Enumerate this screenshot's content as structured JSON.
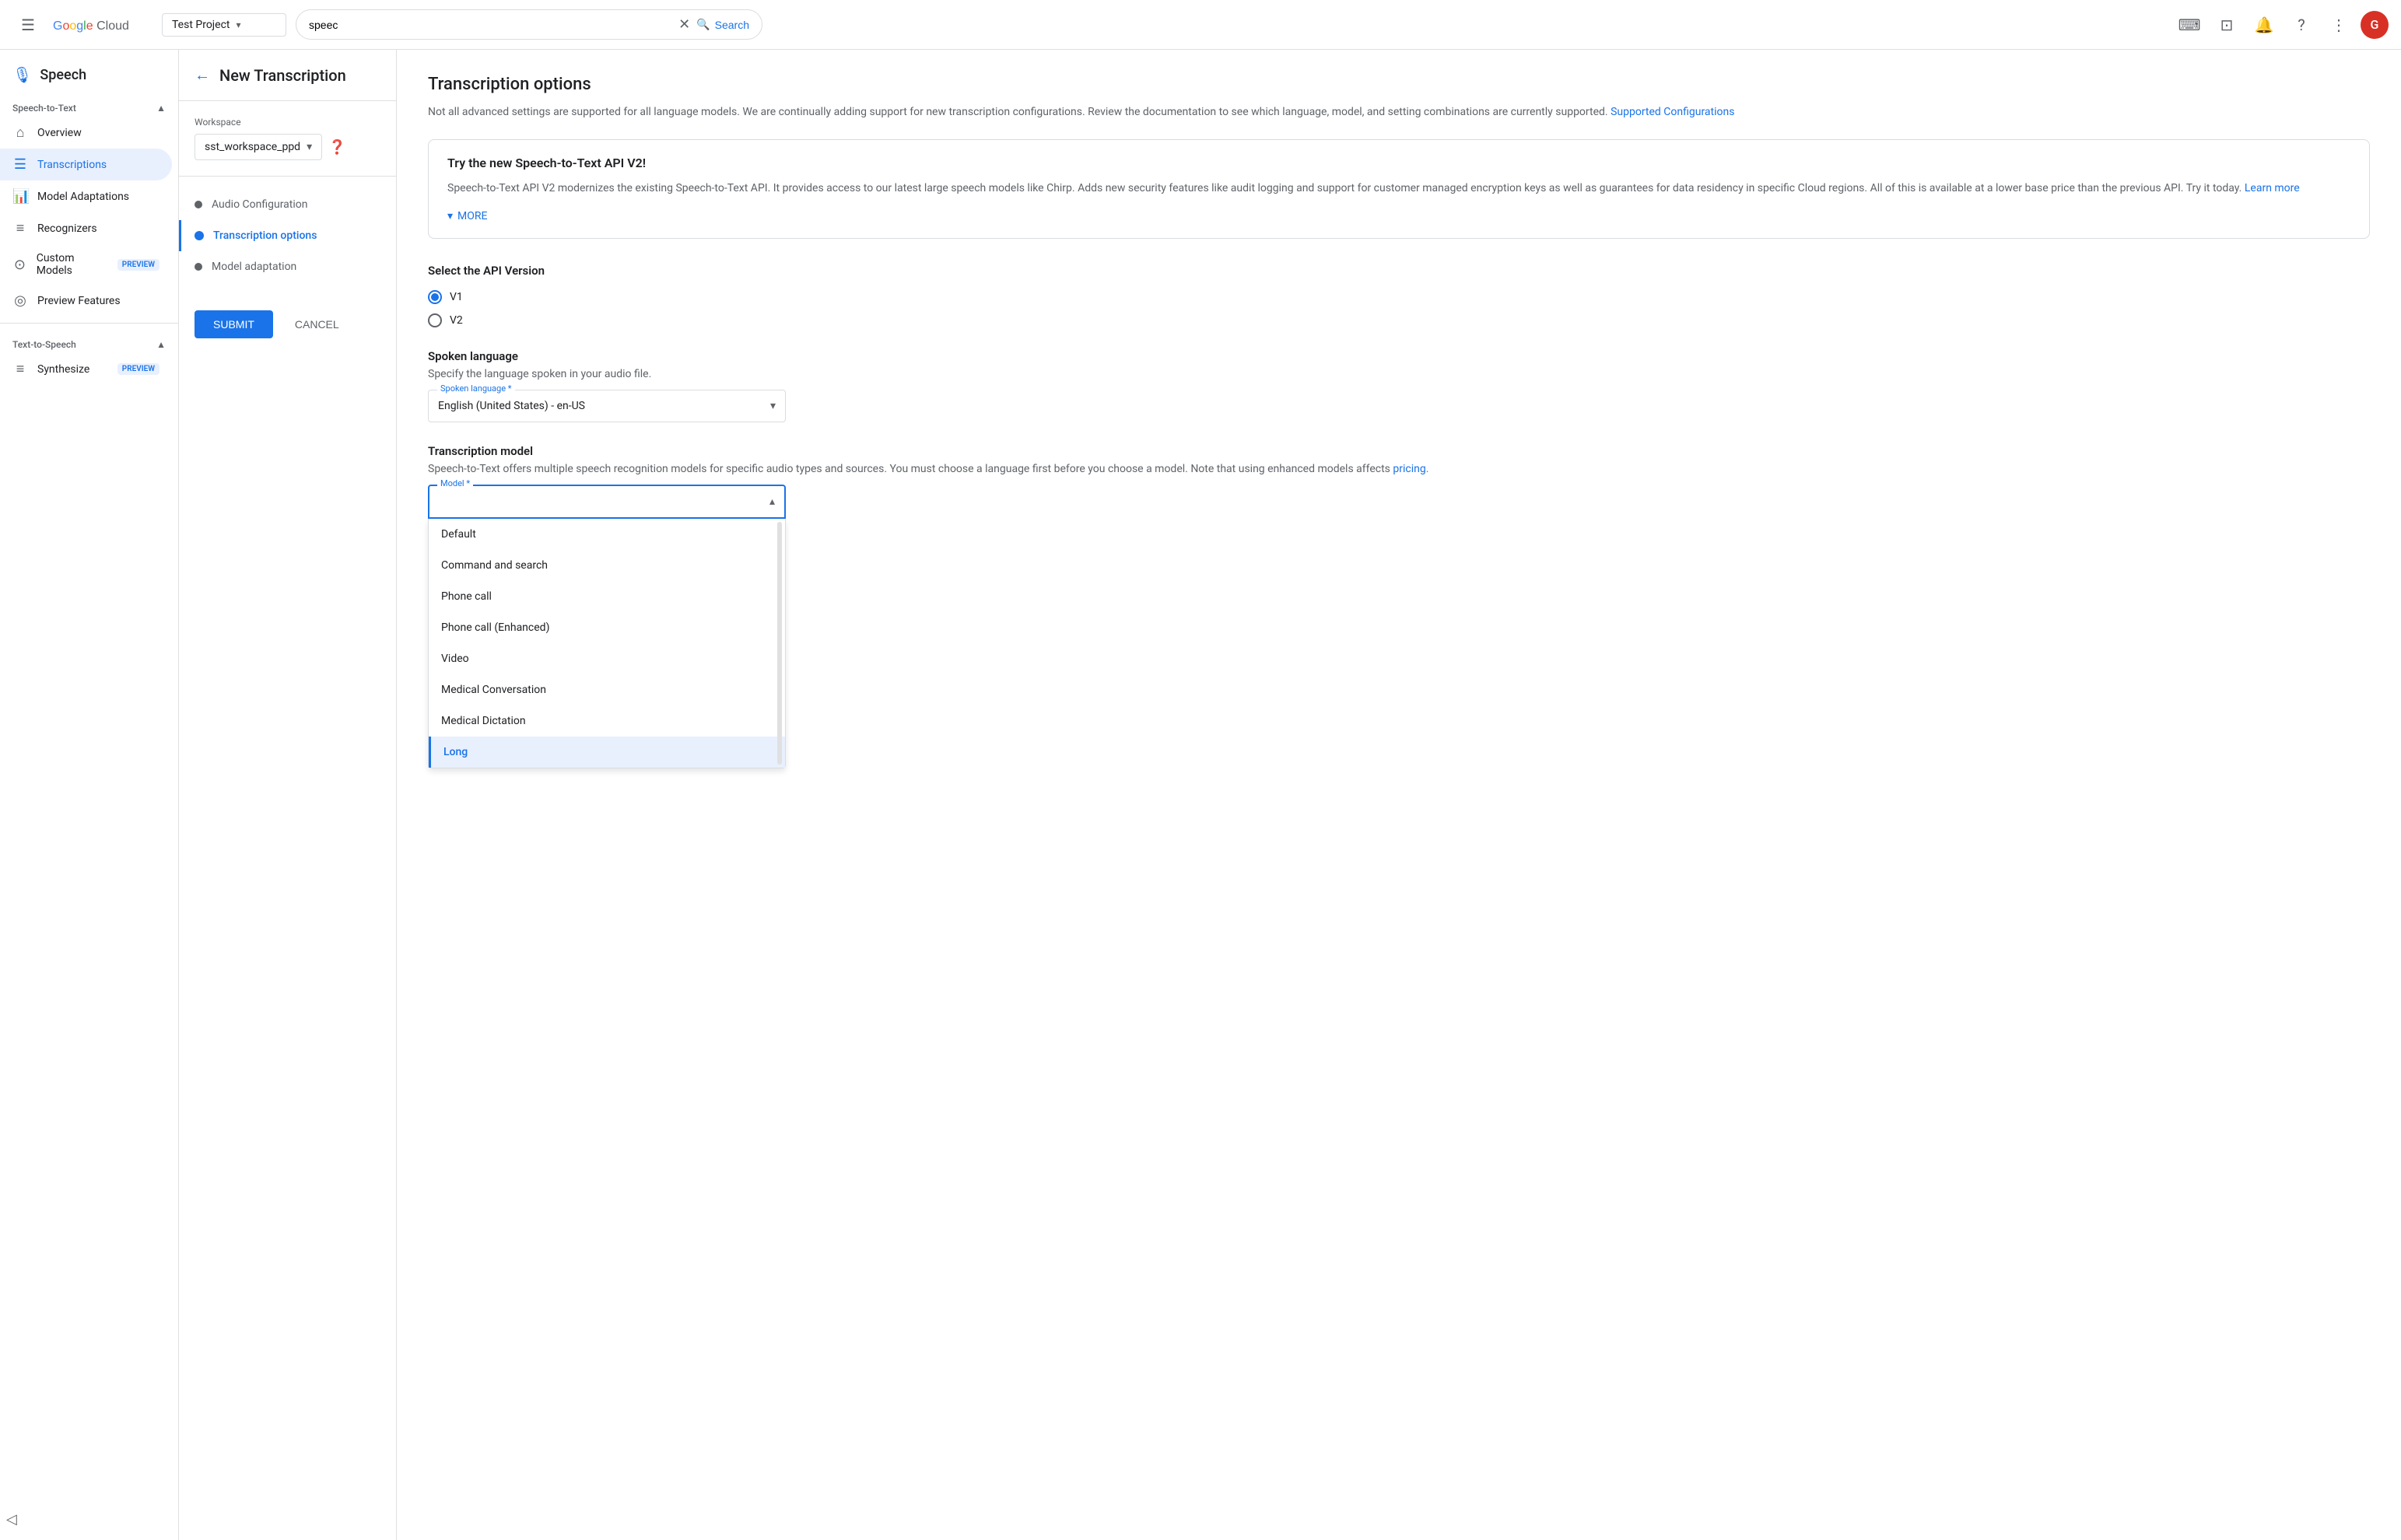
{
  "topbar": {
    "search_placeholder": "speec",
    "search_value": "speec",
    "search_label": "Search",
    "project_name": "Test Project",
    "avatar_initial": "G"
  },
  "sidebar": {
    "app_title": "Speech",
    "speech_to_text_label": "Speech-to-Text",
    "items_stt": [
      {
        "id": "overview",
        "label": "Overview",
        "icon": "⌂"
      },
      {
        "id": "transcriptions",
        "label": "Transcriptions",
        "icon": "☰",
        "active": true
      },
      {
        "id": "model-adaptations",
        "label": "Model Adaptations",
        "icon": "≡"
      },
      {
        "id": "recognizers",
        "label": "Recognizers",
        "icon": "≡"
      },
      {
        "id": "custom-models",
        "label": "Custom Models",
        "icon": "⊙",
        "badge": "PREVIEW"
      },
      {
        "id": "preview-features",
        "label": "Preview Features",
        "icon": "◎"
      }
    ],
    "text_to_speech_label": "Text-to-Speech",
    "items_tts": [
      {
        "id": "synthesize",
        "label": "Synthesize",
        "icon": "≡",
        "badge": "PREVIEW"
      }
    ]
  },
  "wizard": {
    "title": "New Transcription",
    "workspace_label": "Workspace",
    "workspace_value": "sst_workspace_ppd",
    "steps": [
      {
        "id": "audio-config",
        "label": "Audio Configuration",
        "active": false
      },
      {
        "id": "transcription-options",
        "label": "Transcription options",
        "active": true
      },
      {
        "id": "model-adaptation",
        "label": "Model adaptation",
        "active": false
      }
    ],
    "submit_label": "SUBMIT",
    "cancel_label": "CANCEL"
  },
  "options": {
    "title": "Transcription options",
    "description": "Not all advanced settings are supported for all language models. We are continually adding support for new transcription configurations. Review the documentation to see which language, model, and setting combinations are currently supported.",
    "supported_configs_link": "Supported Configurations",
    "v2_banner": {
      "title": "Try the new Speech-to-Text API V2!",
      "text": "Speech-to-Text API V2 modernizes the existing Speech-to-Text API. It provides access to our latest large speech models like Chirp. Adds new security features like audit logging and support for customer managed encryption keys as well as guarantees for data residency in specific Cloud regions. All of this is available at a lower base price than the previous API. Try it today.",
      "learn_more_link": "Learn more",
      "more_label": "MORE"
    },
    "api_version": {
      "title": "Select the API Version",
      "options": [
        {
          "id": "v1",
          "label": "V1",
          "selected": true
        },
        {
          "id": "v2",
          "label": "V2",
          "selected": false
        }
      ]
    },
    "spoken_language": {
      "title": "Spoken language",
      "description": "Specify the language spoken in your audio file.",
      "field_label": "Spoken language *",
      "value": "English (United States) - en-US"
    },
    "transcription_model": {
      "title": "Transcription model",
      "description": "Speech-to-Text offers multiple speech recognition models for specific audio types and sources. You must choose a language first before you choose a model. Note that using enhanced models affects",
      "pricing_link": "pricing.",
      "field_label": "Model *",
      "current_value": "",
      "dropdown_items": [
        {
          "id": "default",
          "label": "Default",
          "selected": false
        },
        {
          "id": "command-search",
          "label": "Command and search",
          "selected": false
        },
        {
          "id": "phone-call",
          "label": "Phone call",
          "selected": false
        },
        {
          "id": "phone-call-enhanced",
          "label": "Phone call (Enhanced)",
          "selected": false
        },
        {
          "id": "video",
          "label": "Video",
          "selected": false
        },
        {
          "id": "medical-conversation",
          "label": "Medical Conversation",
          "selected": false
        },
        {
          "id": "medical-dictation",
          "label": "Medical Dictation",
          "selected": false
        },
        {
          "id": "long",
          "label": "Long",
          "selected": true
        }
      ]
    }
  }
}
